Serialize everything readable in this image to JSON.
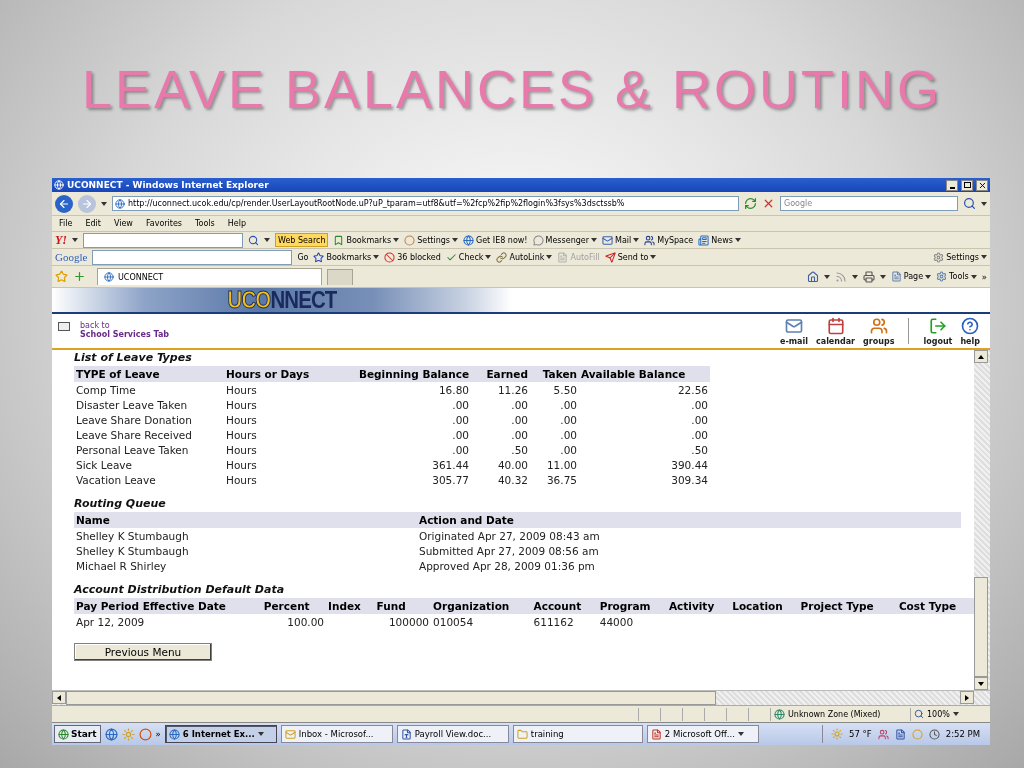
{
  "slide_title": "LEAVE BALANCES & ROUTING",
  "window": {
    "title": "UCONNECT - Windows Internet Explorer"
  },
  "address_bar": {
    "url": "http://uconnect.ucok.edu/cp/render.UserLayoutRootNode.uP?uP_tparam=utf8&utf=%2fcp%2fip%2flogin%3fsys%3dsctssb%",
    "search_placeholder": "Google"
  },
  "menu_bar": [
    "File",
    "Edit",
    "View",
    "Favorites",
    "Tools",
    "Help"
  ],
  "yahoo_toolbar": {
    "logo": "Y!",
    "search_button": "Web Search",
    "items": [
      {
        "label": "Bookmarks",
        "menu": true
      },
      {
        "label": "Settings",
        "menu": true
      },
      {
        "label": "Get IE8 now!",
        "menu": false
      },
      {
        "label": "Messenger",
        "menu": true
      },
      {
        "label": "Mail",
        "menu": true
      },
      {
        "label": "MySpace",
        "menu": false
      },
      {
        "label": "News",
        "menu": true
      }
    ]
  },
  "google_toolbar": {
    "logo": "Google",
    "go_button": "Go",
    "settings": "Settings",
    "items": [
      {
        "label": "Bookmarks",
        "menu": true,
        "disabled": false
      },
      {
        "label": "36 blocked",
        "menu": false,
        "disabled": false
      },
      {
        "label": "Check",
        "menu": true,
        "disabled": false
      },
      {
        "label": "AutoLink",
        "menu": true,
        "disabled": false
      },
      {
        "label": "AutoFill",
        "menu": false,
        "disabled": true
      },
      {
        "label": "Send to",
        "menu": true,
        "disabled": false
      }
    ]
  },
  "tabs": [
    {
      "label": "UCONNECT",
      "selected": true
    }
  ],
  "command_bar": {
    "items": [
      {
        "label": "Page"
      },
      {
        "label": "Tools"
      }
    ],
    "overflow": "»"
  },
  "banner": {
    "highlight": "UCO",
    "rest": "NNECT"
  },
  "back_link": {
    "line_1": "back to",
    "line_2": "School Services Tab"
  },
  "nav_icons": [
    {
      "label": "e-mail"
    },
    {
      "label": "calendar"
    },
    {
      "label": "groups"
    },
    {
      "label": "logout"
    },
    {
      "label": "help"
    }
  ],
  "leave_types": {
    "title": "List of Leave Types",
    "columns": [
      "TYPE of Leave",
      "Hours or Days",
      "Beginning Balance",
      "Earned",
      "Taken",
      "Available Balance"
    ],
    "rows": [
      [
        "Comp Time",
        "Hours",
        "16.80",
        "11.26",
        "5.50",
        "22.56"
      ],
      [
        "Disaster Leave Taken",
        "Hours",
        ".00",
        ".00",
        ".00",
        ".00"
      ],
      [
        "Leave Share Donation",
        "Hours",
        ".00",
        ".00",
        ".00",
        ".00"
      ],
      [
        "Leave Share Received",
        "Hours",
        ".00",
        ".00",
        ".00",
        ".00"
      ],
      [
        "Personal Leave Taken",
        "Hours",
        ".00",
        ".50",
        ".00",
        ".50"
      ],
      [
        "Sick Leave",
        "Hours",
        "361.44",
        "40.00",
        "11.00",
        "390.44"
      ],
      [
        "Vacation Leave",
        "Hours",
        "305.77",
        "40.32",
        "36.75",
        "309.34"
      ]
    ]
  },
  "routing_queue": {
    "title": "Routing Queue",
    "columns": [
      "Name",
      "Action and Date"
    ],
    "rows": [
      [
        "Shelley K Stumbaugh",
        "Originated Apr 27, 2009 08:43 am"
      ],
      [
        "Shelley K Stumbaugh",
        "Submitted Apr 27, 2009 08:56 am"
      ],
      [
        "Michael R Shirley",
        "Approved Apr 28, 2009 01:36 pm"
      ]
    ]
  },
  "account_distribution": {
    "title": "Account Distribution Default Data",
    "columns": [
      "Pay Period Effective Date",
      "Percent",
      "Index",
      "Fund",
      "Organization",
      "Account",
      "Program",
      "Activity",
      "Location",
      "Project Type",
      "Cost Type"
    ],
    "rows": [
      [
        "Apr 12, 2009",
        "100.00",
        null,
        "100000",
        "010054",
        "611162",
        "44000",
        null,
        null,
        null,
        null
      ]
    ]
  },
  "previous_menu_button": "Previous Menu",
  "status_bar": {
    "zone": "Unknown Zone (Mixed)",
    "zoom": "100%"
  },
  "taskbar": {
    "start": "Start",
    "overflow": "»",
    "items": [
      {
        "label": "6 Internet Ex...",
        "selected": true,
        "menu": true
      },
      {
        "label": "Inbox - Microsof...",
        "selected": false,
        "menu": false
      },
      {
        "label": "Payroll View.doc...",
        "selected": false,
        "menu": false
      },
      {
        "label": "training",
        "selected": false,
        "menu": false
      },
      {
        "label": "2 Microsoft Off...",
        "selected": false,
        "menu": true
      }
    ],
    "temperature": "57 °F",
    "clock": "2:52 PM"
  }
}
